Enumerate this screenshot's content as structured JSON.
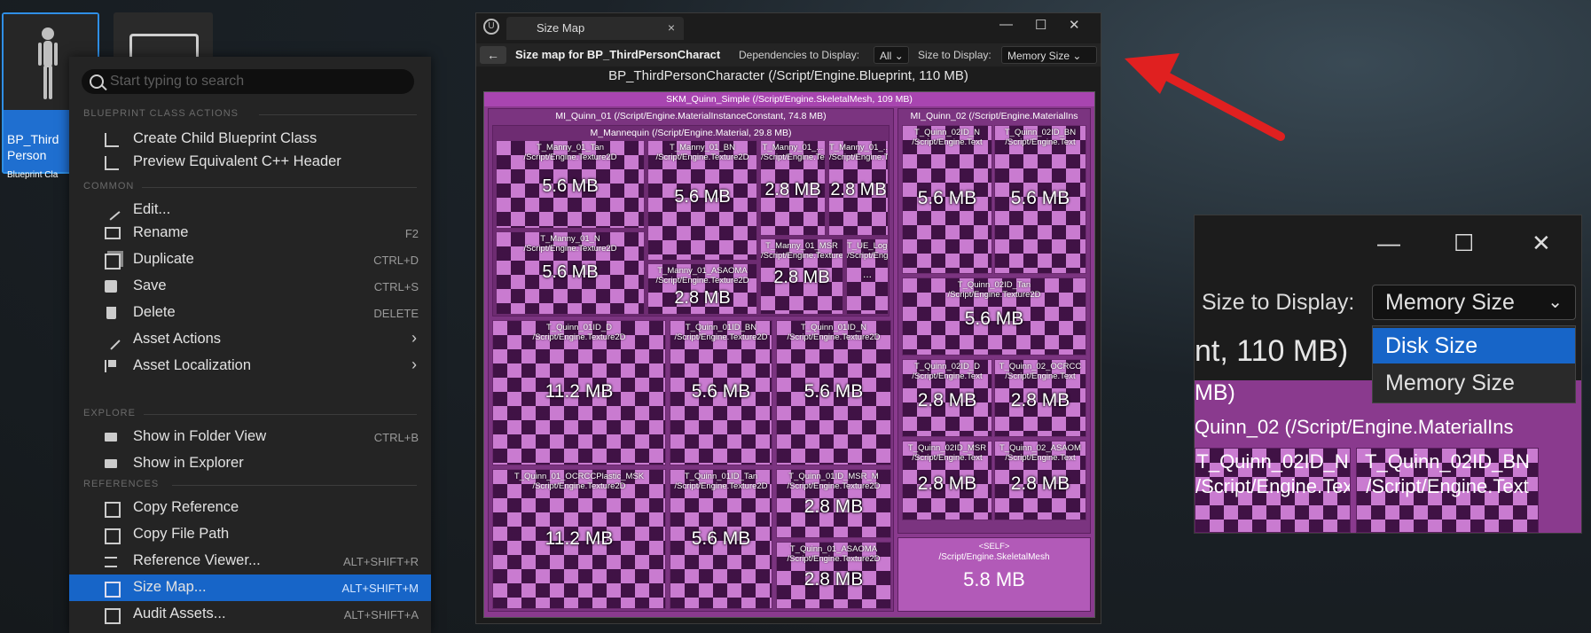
{
  "content_browser": {
    "selected_asset": {
      "name": "BP_Third Person",
      "class": "Blueprint Cla"
    }
  },
  "context_menu": {
    "search_placeholder": "Start typing to search",
    "sections": {
      "blueprint": "BLUEPRINT CLASS ACTIONS",
      "common": "COMMON",
      "explore": "EXPLORE",
      "references": "REFERENCES"
    },
    "items": {
      "create_child": {
        "label": "Create Child Blueprint Class"
      },
      "preview_cpp": {
        "label": "Preview Equivalent C++ Header"
      },
      "edit": {
        "label": "Edit..."
      },
      "rename": {
        "label": "Rename",
        "shortcut": "F2"
      },
      "duplicate": {
        "label": "Duplicate",
        "shortcut": "CTRL+D"
      },
      "save": {
        "label": "Save",
        "shortcut": "CTRL+S"
      },
      "delete": {
        "label": "Delete",
        "shortcut": "DELETE"
      },
      "asset_actions": {
        "label": "Asset Actions"
      },
      "asset_localization": {
        "label": "Asset Localization"
      },
      "show_folder": {
        "label": "Show in Folder View",
        "shortcut": "CTRL+B"
      },
      "show_explorer": {
        "label": "Show in Explorer"
      },
      "copy_reference": {
        "label": "Copy Reference"
      },
      "copy_path": {
        "label": "Copy File Path"
      },
      "reference_viewer": {
        "label": "Reference Viewer...",
        "shortcut": "ALT+SHIFT+R"
      },
      "size_map": {
        "label": "Size Map...",
        "shortcut": "ALT+SHIFT+M"
      },
      "audit_assets": {
        "label": "Audit Assets...",
        "shortcut": "ALT+SHIFT+A"
      }
    }
  },
  "size_map_window": {
    "tab_title": "Size Map",
    "window_controls": {
      "minimize": "—",
      "maximize": "☐",
      "close": "✕"
    },
    "toolbar": {
      "back": "←",
      "title": "Size map for BP_ThirdPersonCharact",
      "deps_label": "Dependencies to Display:",
      "deps_value": "All",
      "size_label": "Size to Display:",
      "size_value": "Memory Size"
    },
    "root_title": "BP_ThirdPersonCharacter  (/Script/Engine.Blueprint, 110 MB)",
    "mesh_header": "SKM_Quinn_Simple  (/Script/Engine.SkeletalMesh, 109 MB)",
    "mi01_header": "MI_Quinn_01  (/Script/Engine.MaterialInstanceConstant, 74.8 MB)",
    "mi02_header": "MI_Quinn_02  (/Script/Engine.MaterialIns",
    "mmannequin_header": "M_Mannequin  (/Script/Engine.Material, 29.8 MB)",
    "texture_path": "/Script/Engine.Texture2D",
    "texture_path_short": "/Script/Engine.Text",
    "tiles": [
      {
        "name": "T_Manny_01_Tan",
        "size": "5.6 MB"
      },
      {
        "name": "T_Manny_01_BN",
        "size": "5.6 MB"
      },
      {
        "name": "T_Manny_01_...",
        "size": "2.8 MB"
      },
      {
        "name": "T_Manny_01_...",
        "size": "2.8 MB"
      },
      {
        "name": "T_Manny_01_N",
        "size": "5.6 MB"
      },
      {
        "name": "T_Manny_01_ASAOMA",
        "size": "2.8 MB"
      },
      {
        "name": "T_Manny_01_MSR",
        "size": "2.8 MB"
      },
      {
        "name": "T_UE_Logo",
        "size": "..."
      },
      {
        "name": "T_Quinn_01ID_D",
        "size": "11.2 MB"
      },
      {
        "name": "T_Quinn_01ID_BN",
        "size": "5.6 MB"
      },
      {
        "name": "T_Quinn_01ID_N",
        "size": "5.6 MB"
      },
      {
        "name": "T_Quinn_01_OCRCCPlastic_MSK",
        "size": "11.2 MB"
      },
      {
        "name": "T_Quinn_01ID_Tan",
        "size": "5.6 MB"
      },
      {
        "name": "T_Quinn_01ID_MSR_M",
        "size": "2.8 MB"
      },
      {
        "name": "T_Quinn_01_ASAOMA",
        "size": "2.8 MB"
      },
      {
        "name": "T_Quinn_02ID_N",
        "size": "5.6 MB"
      },
      {
        "name": "T_Quinn_02ID_BN",
        "size": "5.6 MB"
      },
      {
        "name": "T_Quinn_02ID_Tan",
        "size": "5.6 MB"
      },
      {
        "name": "T_Quinn_02ID_D",
        "size": "2.8 MB"
      },
      {
        "name": "T_Quinn_02_OCRCC",
        "size": "2.8 MB"
      },
      {
        "name": "T_Quinn_02ID_MSR",
        "size": "2.8 MB"
      },
      {
        "name": "T_Quinn_02_ASAOM",
        "size": "2.8 MB"
      }
    ],
    "self_tile": {
      "name": "<SELF>",
      "path": "/Script/Engine.SkeletalMesh",
      "size": "5.8 MB"
    }
  },
  "zoom_inset": {
    "window_controls": {
      "minimize": "—",
      "maximize": "☐",
      "close": "✕"
    },
    "size_label": "Size to Display:",
    "size_value": "Memory Size",
    "options": [
      "Disk Size",
      "Memory Size"
    ],
    "highlighted_option": "Disk Size",
    "title_fragment": "nt, 110 MB)",
    "mesh_fragment": "MB)",
    "mi_fragment": "Quinn_02  (/Script/Engine.MaterialIns",
    "cells": [
      {
        "name": "T_Quinn_02ID_N",
        "path": "/Script/Engine.Text"
      },
      {
        "name": "T_Quinn_02ID_BN",
        "path": "/Script/Engine.Text"
      }
    ]
  },
  "colors": {
    "accent": "#1765c8",
    "arrow": "#e02020",
    "treemap": "#8a3a8e"
  }
}
